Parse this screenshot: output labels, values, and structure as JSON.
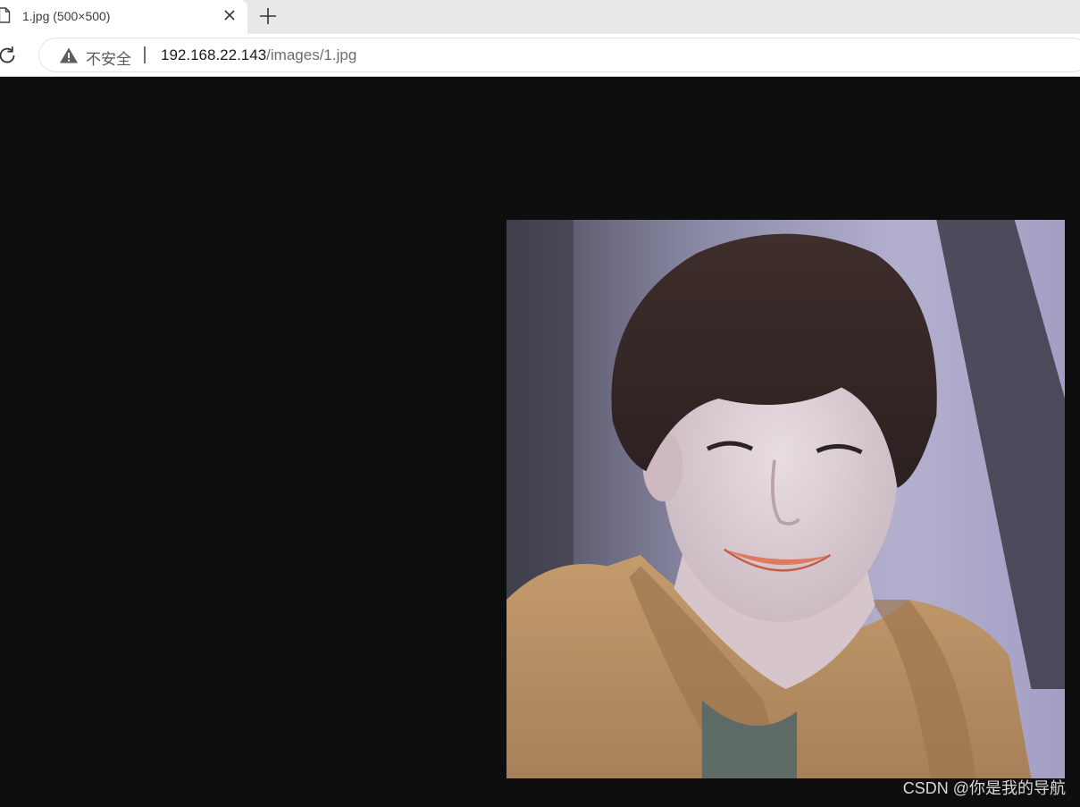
{
  "tab": {
    "title": "1.jpg (500×500)",
    "icon": "file-icon",
    "close_icon": "close-icon"
  },
  "new_tab_icon": "plus-icon",
  "toolbar": {
    "reload_icon": "reload-icon",
    "security_icon": "warning-icon",
    "security_label": "不安全",
    "url_host": "192.168.22.143",
    "url_path": "/images/1.jpg"
  },
  "watermark": "CSDN @你是我的导航",
  "colors": {
    "viewer_background": "#0e0e0f",
    "tabstrip_background": "#e8e8e8"
  }
}
